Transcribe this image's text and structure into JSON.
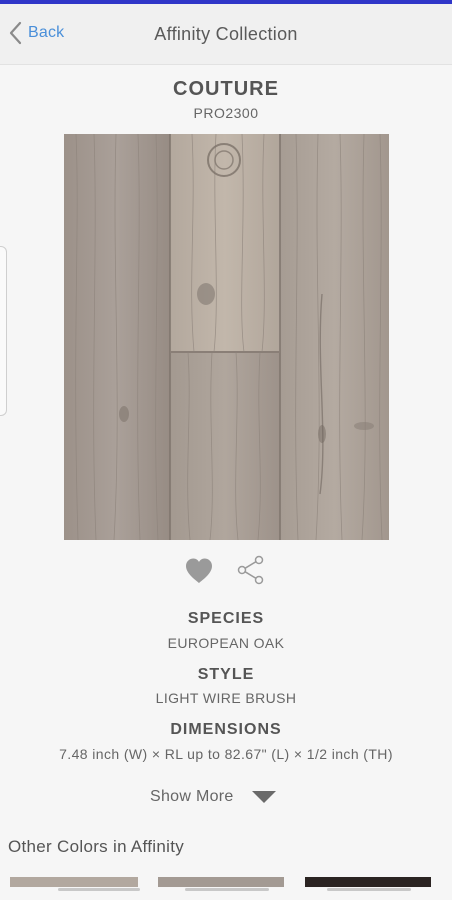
{
  "nav": {
    "back_label": "Back",
    "title": "Affinity Collection"
  },
  "product": {
    "name": "COUTURE",
    "code": "PRO2300"
  },
  "specs": {
    "species_label": "SPECIES",
    "species_value": "EUROPEAN OAK",
    "style_label": "STYLE",
    "style_value": "LIGHT WIRE BRUSH",
    "dimensions_label": "DIMENSIONS",
    "dimensions_value": "7.48 inch (W) × RL up to 82.67\" (L) × 1/2 inch (TH)"
  },
  "show_more_label": "Show More",
  "other_colors_title": "Other Colors in Affinity",
  "colors": {
    "accent_link": "#4a8fd9",
    "top_line": "#2f36c8",
    "wood_base": "#a79d95"
  },
  "icons": {
    "back": "chevron-left-icon",
    "favorite": "heart-icon",
    "share": "share-icon",
    "show_more": "caret-down-icon"
  }
}
